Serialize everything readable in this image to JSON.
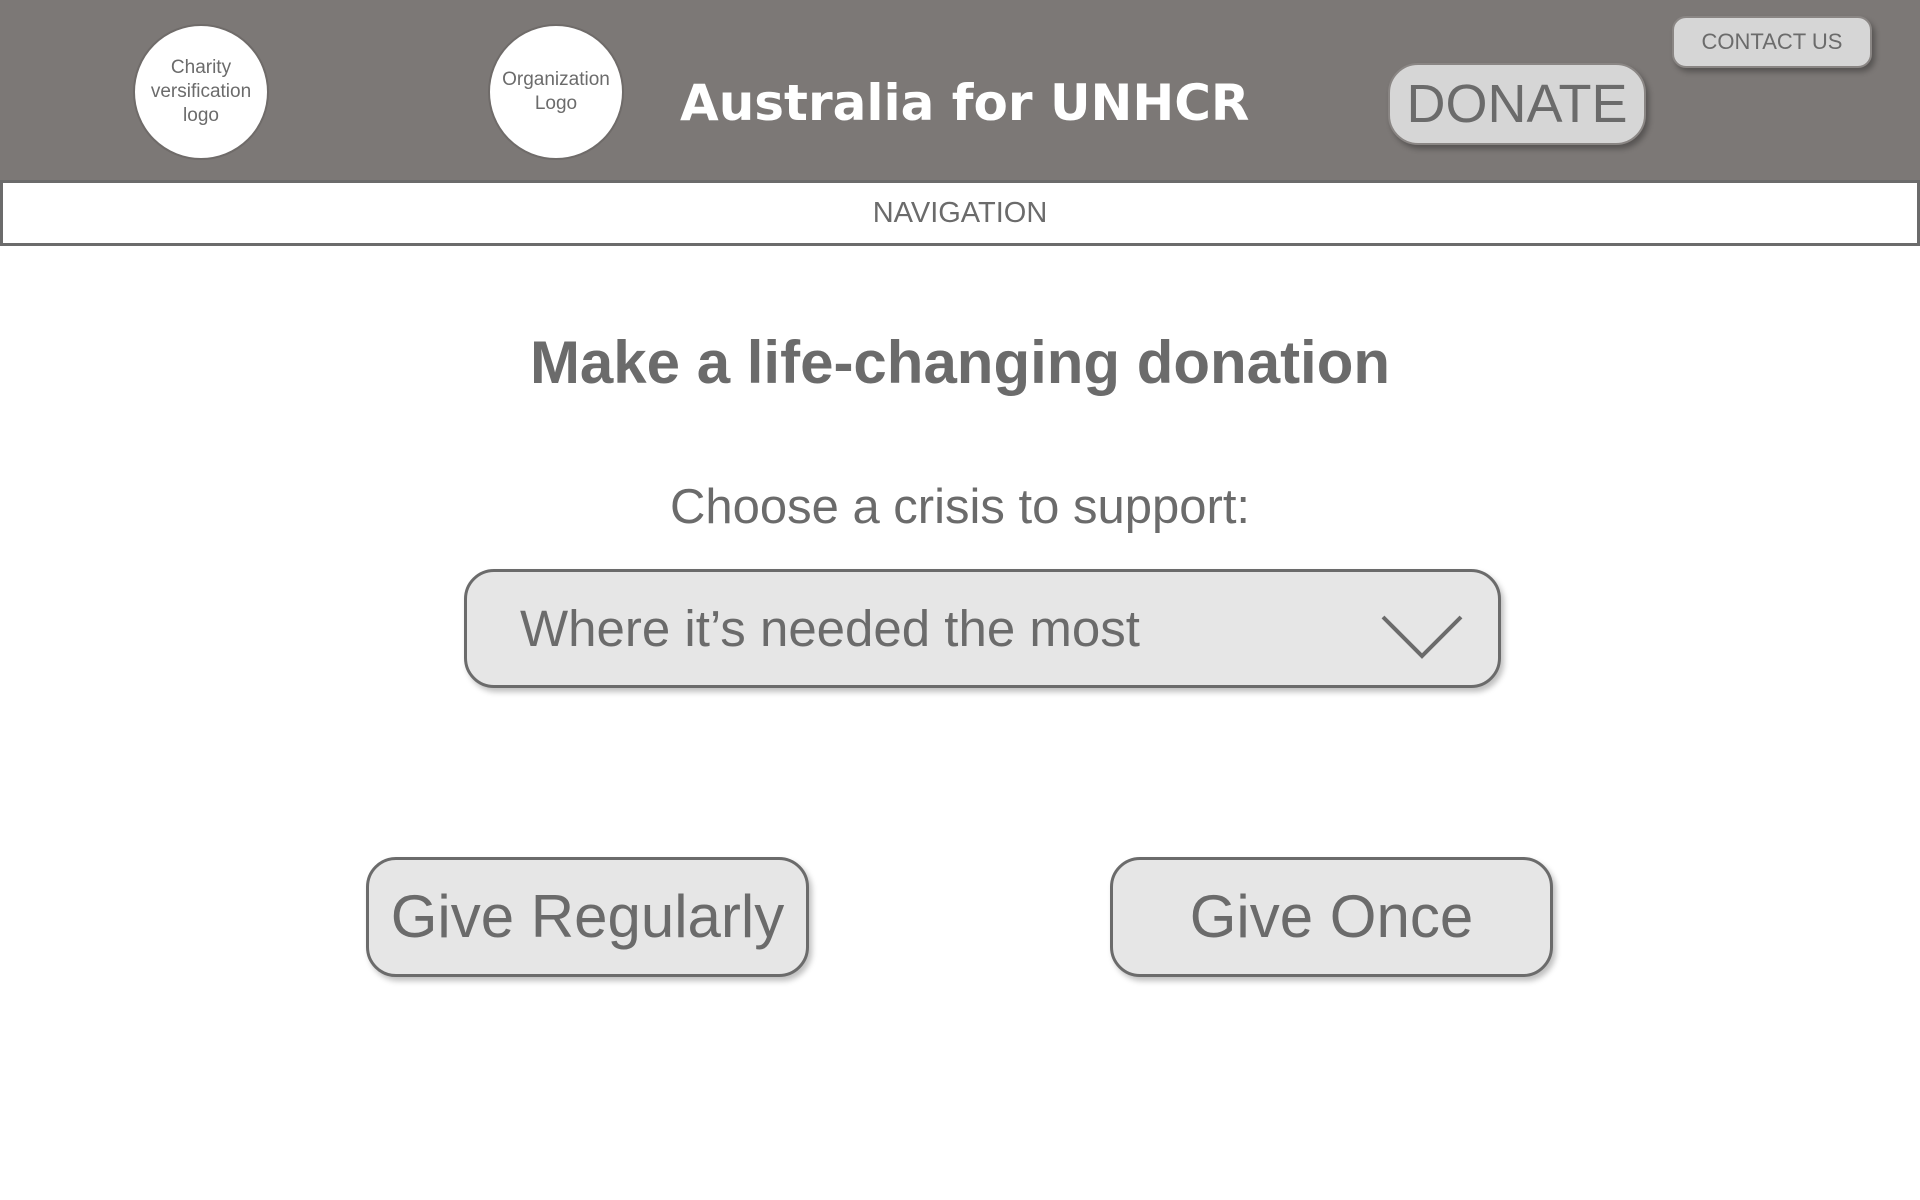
{
  "header": {
    "charity_logo_text": "Charity versification logo",
    "org_logo_text": "Organization Logo",
    "title": "Australia for UNHCR",
    "donate_label": "DONATE",
    "contact_label": "CONTACT US"
  },
  "navigation": {
    "label": "NAVIGATION"
  },
  "main": {
    "heading": "Make a life-changing donation",
    "crisis_label": "Choose a crisis to support:",
    "crisis_selected": "Where it’s needed the most",
    "crisis_dropdown_icon": "chevron-down-icon",
    "give_regularly_label": "Give Regularly",
    "give_once_label": "Give Once"
  },
  "colors": {
    "header_background": "#7c7876",
    "button_fill": "#e6e6e6",
    "text_gray": "#6b6b6b",
    "title_text": "#ffffff"
  }
}
